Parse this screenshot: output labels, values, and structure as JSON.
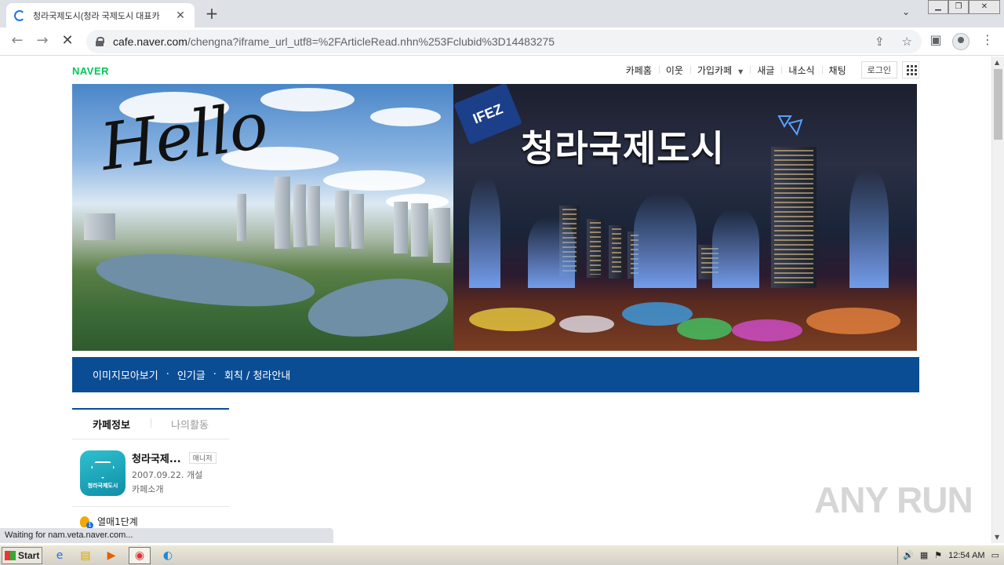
{
  "browser": {
    "tab_title": "청라국제도시(청라 국제도시 대표카",
    "tab_close": "✕",
    "new_tab": "+",
    "tab_search": "⌄",
    "url_host": "cafe.naver.com",
    "url_path": "/chengna?iframe_url_utf8=%2FArticleRead.nhn%253Fclubid%3D14483275",
    "status_text": "Waiting for nam.veta.naver.com..."
  },
  "site": {
    "logo": "NAVER",
    "gnb": [
      "카페홈",
      "이웃",
      "가입카페",
      "새글",
      "내소식",
      "채팅"
    ],
    "login": "로그인"
  },
  "banner": {
    "hello": "Hello",
    "flag_text": "IFEZ",
    "title": "청라국제도시"
  },
  "menu": {
    "items": [
      "이미지모아보기",
      "인기글",
      "회칙 / 청라안내"
    ],
    "separator": "·"
  },
  "sidebar": {
    "tabs": [
      "카페정보",
      "나의활동"
    ],
    "cafe_name": "청라국제...",
    "manager_badge": "매니저",
    "open_date": "2007.09.22. 개설",
    "intro_link": "카페소개",
    "logo_label": "청라국제도시",
    "level": "열매1단계"
  },
  "watermark": "ANY RUN",
  "taskbar": {
    "start": "Start",
    "clock": "12:54 AM"
  }
}
